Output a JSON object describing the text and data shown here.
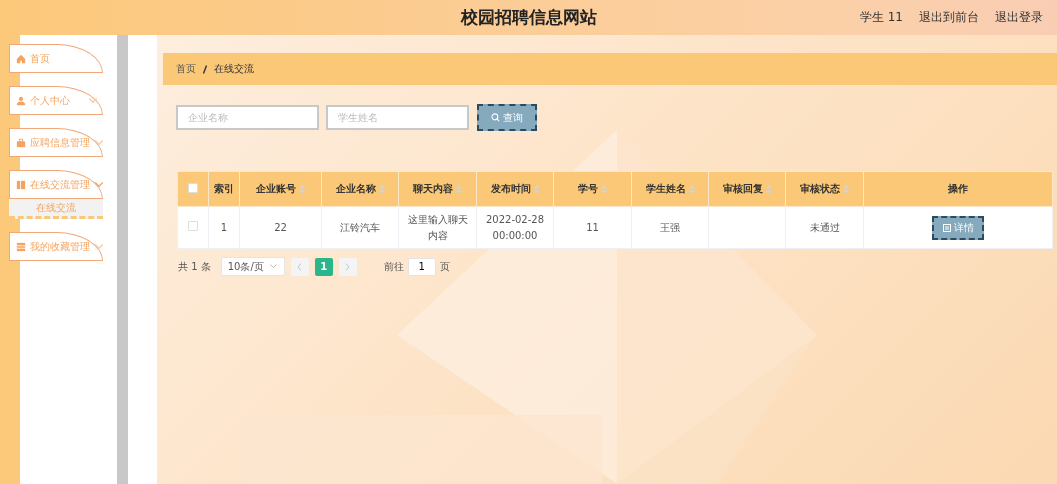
{
  "header": {
    "title": "校园招聘信息网站",
    "user_label": "学生 11",
    "links": [
      "退出到前台",
      "退出登录"
    ]
  },
  "sidebar": {
    "items": [
      {
        "label": "首页",
        "kind": "link"
      },
      {
        "label": "个人中心",
        "kind": "menu",
        "expanded": false
      },
      {
        "label": "应聘信息管理",
        "kind": "menu",
        "expanded": false
      },
      {
        "label": "在线交流管理",
        "kind": "menu",
        "expanded": true,
        "children": [
          {
            "label": "在线交流",
            "selected": true
          }
        ]
      },
      {
        "label": "我的收藏管理",
        "kind": "menu",
        "expanded": false
      }
    ]
  },
  "breadcrumb": [
    "首页",
    "在线交流"
  ],
  "search": {
    "fields": [
      {
        "placeholder": "企业名称"
      },
      {
        "placeholder": "学生姓名"
      }
    ],
    "button": "查询"
  },
  "table": {
    "header_checked": false,
    "columns": [
      {
        "label": "索引",
        "sortable": false
      },
      {
        "label": "企业账号",
        "sortable": true
      },
      {
        "label": "企业名称",
        "sortable": true
      },
      {
        "label": "聊天内容",
        "sortable": true
      },
      {
        "label": "发布时间",
        "sortable": true
      },
      {
        "label": "学号",
        "sortable": true
      },
      {
        "label": "学生姓名",
        "sortable": true
      },
      {
        "label": "审核回复",
        "sortable": true
      },
      {
        "label": "审核状态",
        "sortable": true
      },
      {
        "label": "操作",
        "sortable": false
      }
    ],
    "rows": [
      {
        "checked": false,
        "cells": [
          "1",
          "22",
          "江铃汽车",
          "这里输入聊天内容",
          "2022-02-28 00:00:00",
          "11",
          "王强",
          "",
          "未通过"
        ],
        "action": "详情"
      }
    ]
  },
  "pagination": {
    "total": "共 1 条",
    "page_size": "10条/页",
    "pages": [
      {
        "label": "1",
        "selected": true
      }
    ],
    "goto_label": "前往",
    "goto_value": "1",
    "page_suffix": "页"
  }
}
